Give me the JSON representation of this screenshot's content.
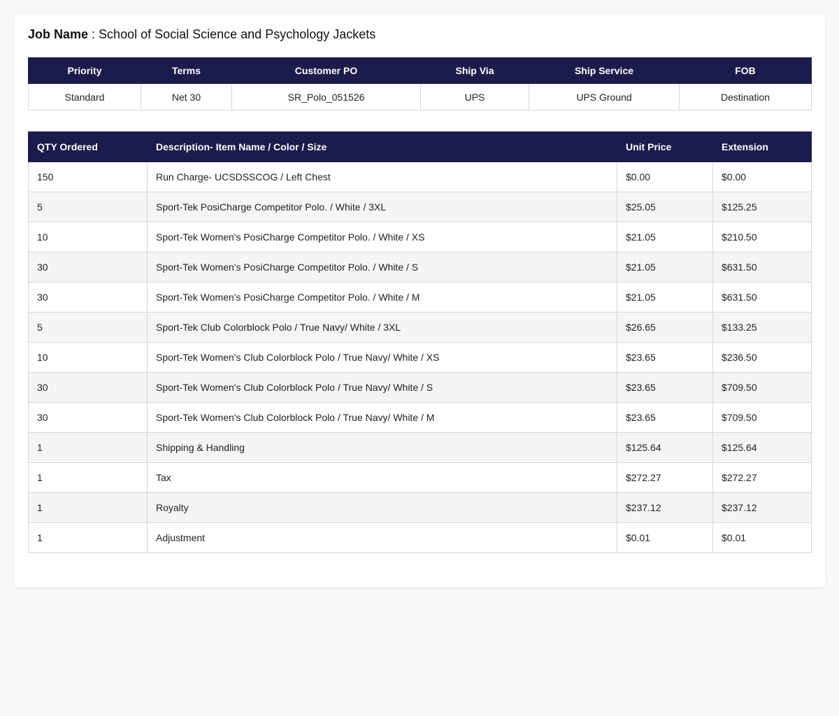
{
  "job": {
    "label": "Job Name",
    "separator": " : ",
    "name": "School of Social Science and Psychology Jackets"
  },
  "meta": {
    "headers": [
      "Priority",
      "Terms",
      "Customer PO",
      "Ship Via",
      "Ship Service",
      "FOB"
    ],
    "values": [
      "Standard",
      "Net 30",
      "SR_Polo_051526",
      "UPS",
      "UPS Ground",
      "Destination"
    ]
  },
  "items": {
    "headers": [
      "QTY Ordered",
      "Description- Item Name / Color / Size",
      "Unit Price",
      "Extension"
    ],
    "rows": [
      [
        "150",
        "Run Charge- UCSDSSCOG / Left Chest",
        "$0.00",
        "$0.00"
      ],
      [
        "5",
        "Sport-Tek PosiCharge Competitor Polo. / White / 3XL",
        "$25.05",
        "$125.25"
      ],
      [
        "10",
        "Sport-Tek Women's PosiCharge Competitor Polo. / White / XS",
        "$21.05",
        "$210.50"
      ],
      [
        "30",
        "Sport-Tek Women's PosiCharge Competitor Polo. / White / S",
        "$21.05",
        "$631.50"
      ],
      [
        "30",
        "Sport-Tek Women's PosiCharge Competitor Polo. / White / M",
        "$21.05",
        "$631.50"
      ],
      [
        "5",
        "Sport-Tek Club Colorblock Polo / True Navy/ White / 3XL",
        "$26.65",
        "$133.25"
      ],
      [
        "10",
        "Sport-Tek Women's Club Colorblock Polo / True Navy/ White / XS",
        "$23.65",
        "$236.50"
      ],
      [
        "30",
        "Sport-Tek Women's Club Colorblock Polo / True Navy/ White / S",
        "$23.65",
        "$709.50"
      ],
      [
        "30",
        "Sport-Tek Women's Club Colorblock Polo / True Navy/ White / M",
        "$23.65",
        "$709.50"
      ],
      [
        "1",
        "Shipping & Handling",
        "$125.64",
        "$125.64"
      ],
      [
        "1",
        "Tax",
        "$272.27",
        "$272.27"
      ],
      [
        "1",
        "Royalty",
        "$237.12",
        "$237.12"
      ],
      [
        "1",
        "Adjustment",
        "$0.01",
        "$0.01"
      ]
    ]
  },
  "colors": {
    "header_bg": "#1c1c4c",
    "row_alt_bg": "#f5f5f5",
    "page_bg": "#f9f9f9"
  }
}
